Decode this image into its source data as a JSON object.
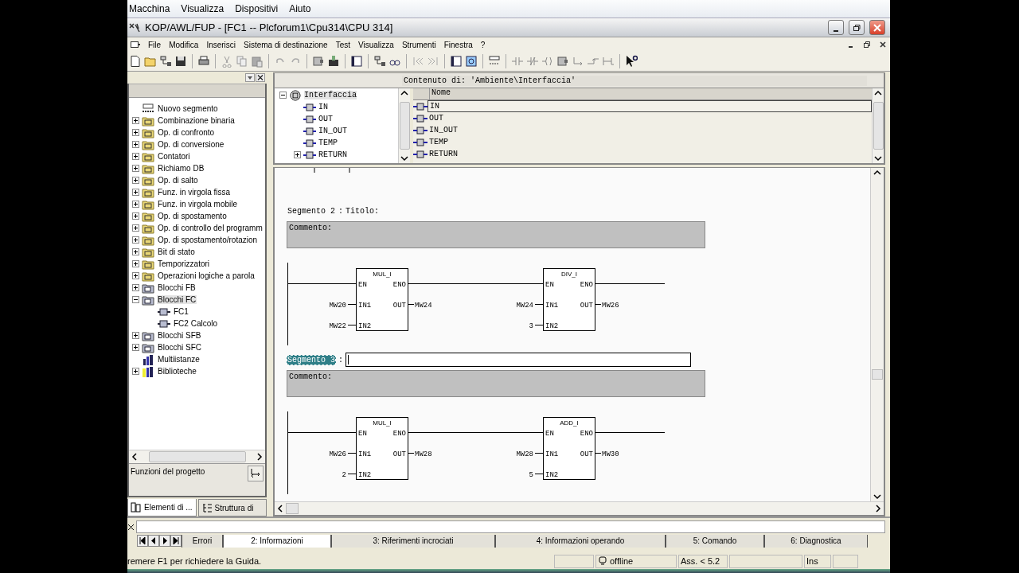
{
  "host_menu": [
    "Macchina",
    "Visualizza",
    "Dispositivi",
    "Aiuto"
  ],
  "window": {
    "title": "KOP/AWL/FUP  - [FC1 -- Plcforum1\\Cpu314\\CPU 314]"
  },
  "menu": [
    "File",
    "Modifica",
    "Inserisci",
    "Sistema di destinazione",
    "Test",
    "Visualizza",
    "Strumenti",
    "Finestra",
    "?"
  ],
  "catalog": {
    "items": [
      {
        "label": "Nuovo segmento",
        "kind": "new",
        "selected": false
      },
      {
        "label": "Combinazione binaria",
        "kind": "folder",
        "expanded": false,
        "selected": false
      },
      {
        "label": "Op. di confronto",
        "kind": "folder",
        "expanded": false,
        "selected": false
      },
      {
        "label": "Op. di conversione",
        "kind": "folder",
        "expanded": false,
        "selected": false
      },
      {
        "label": "Contatori",
        "kind": "folder",
        "expanded": false,
        "selected": false
      },
      {
        "label": "Richiamo DB",
        "kind": "folder",
        "expanded": false,
        "selected": false
      },
      {
        "label": "Op. di salto",
        "kind": "folder",
        "expanded": false,
        "selected": false
      },
      {
        "label": "Funz. in virgola fissa",
        "kind": "folder",
        "expanded": false,
        "selected": false
      },
      {
        "label": "Funz. in virgola mobile",
        "kind": "folder",
        "expanded": false,
        "selected": false
      },
      {
        "label": "Op. di spostamento",
        "kind": "folder",
        "expanded": false,
        "selected": false
      },
      {
        "label": "Op. di controllo del programm",
        "kind": "folder",
        "expanded": false,
        "selected": false
      },
      {
        "label": "Op. di spostamento/rotazion",
        "kind": "folder",
        "expanded": false,
        "selected": false
      },
      {
        "label": "Bit di stato",
        "kind": "folder",
        "expanded": false,
        "selected": false
      },
      {
        "label": "Temporizzatori",
        "kind": "folder",
        "expanded": false,
        "selected": false
      },
      {
        "label": "Operazioni logiche a parola",
        "kind": "folder",
        "expanded": false,
        "selected": false
      },
      {
        "label": "Blocchi FB",
        "kind": "blockfolder",
        "expanded": false,
        "selected": false
      },
      {
        "label": "Blocchi FC",
        "kind": "blockfolder",
        "expanded": true,
        "selected": true,
        "children": [
          {
            "label": "FC1",
            "kind": "block",
            "selected": false
          },
          {
            "label": "FC2   Calcolo",
            "kind": "block",
            "selected": false
          }
        ]
      },
      {
        "label": "Blocchi SFB",
        "kind": "blockfolder",
        "expanded": false,
        "selected": false
      },
      {
        "label": "Blocchi SFC",
        "kind": "blockfolder",
        "expanded": false,
        "selected": false
      },
      {
        "label": "Multiistanze",
        "kind": "multi",
        "selected": false
      },
      {
        "label": "Biblioteche",
        "kind": "library",
        "expanded": false,
        "selected": false
      }
    ],
    "footer": "Funzioni del progetto",
    "tabs": [
      {
        "label": "Elementi di ...",
        "selected": true
      },
      {
        "label": "Struttura di",
        "selected": false
      }
    ]
  },
  "interface": {
    "header": "Contenuto di: 'Ambiente\\Interfaccia'",
    "tree": {
      "label": "Interfaccia",
      "expanded": true,
      "selected": true,
      "children": [
        {
          "label": "IN",
          "selected": false
        },
        {
          "label": "OUT",
          "selected": false
        },
        {
          "label": "IN_OUT",
          "selected": false
        },
        {
          "label": "TEMP",
          "selected": false
        },
        {
          "label": "RETURN",
          "expanded": false,
          "selected": false
        }
      ]
    },
    "column": "Nome",
    "rows": [
      {
        "name": "IN",
        "selected": true
      },
      {
        "name": "OUT",
        "selected": false
      },
      {
        "name": "IN_OUT",
        "selected": false
      },
      {
        "name": "TEMP",
        "selected": false
      },
      {
        "name": "RETURN",
        "selected": false
      }
    ]
  },
  "networks": [
    {
      "label": "Segmento 2",
      "selected": false,
      "separator": ":",
      "title": "Titolo:",
      "comment": "Commento:",
      "blocks": [
        {
          "name": "MUL_I",
          "en": "EN",
          "eno": "ENO",
          "in1": "IN1",
          "in2": "IN2",
          "out": "OUT",
          "in1_operand": "MW20",
          "in2_operand": "MW22",
          "out_operand": "MW24"
        },
        {
          "name": "DIV_I",
          "en": "EN",
          "eno": "ENO",
          "in1": "IN1",
          "in2": "IN2",
          "out": "OUT",
          "in1_operand": "MW24",
          "in2_operand": "3",
          "out_operand": "MW26"
        }
      ]
    },
    {
      "label": "Segmento 3",
      "selected": true,
      "separator": ":",
      "comment": "Commento:",
      "blocks": [
        {
          "name": "MUL_I",
          "en": "EN",
          "eno": "ENO",
          "in1": "IN1",
          "in2": "IN2",
          "out": "OUT",
          "in1_operand": "MW26",
          "in2_operand": "2",
          "out_operand": "MW28"
        },
        {
          "name": "ADD_I",
          "en": "EN",
          "eno": "ENO",
          "in1": "IN1",
          "in2": "IN2",
          "out": "OUT",
          "in1_operand": "MW28",
          "in2_operand": "5",
          "out_operand": "MW30"
        }
      ]
    }
  ],
  "output": {
    "tabs": [
      {
        "label": "Errori",
        "selected": false
      },
      {
        "label": "2: Informazioni",
        "selected": true
      },
      {
        "label": "3: Riferimenti incrociati",
        "selected": false
      },
      {
        "label": "4: Informazioni operando",
        "selected": false
      },
      {
        "label": "5: Comando",
        "selected": false
      },
      {
        "label": "6: Diagnostica",
        "selected": false
      }
    ]
  },
  "status": {
    "hint": "remere F1 per richiedere la Guida.",
    "mode": "offline",
    "version": "Ass. < 5.2",
    "insert": "Ins"
  }
}
